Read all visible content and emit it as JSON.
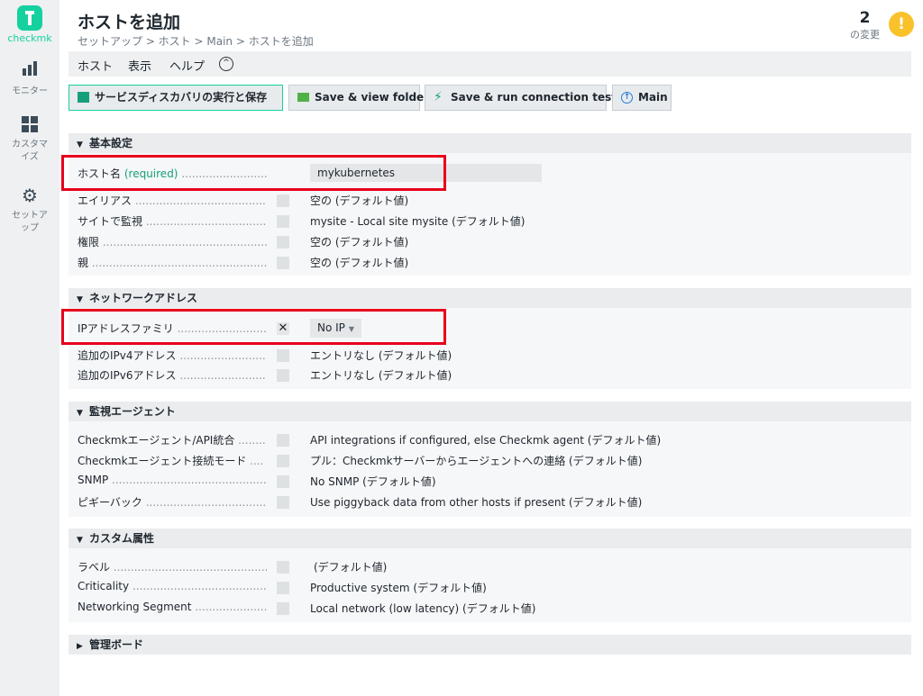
{
  "sidebar": {
    "logo": "checkmk",
    "items": [
      {
        "label": "モニター"
      },
      {
        "label": "カスタマイズ"
      },
      {
        "label": "セットアップ"
      }
    ]
  },
  "header": {
    "title": "ホストを追加",
    "breadcrumb": "セットアップ > ホスト > Main > ホストを追加",
    "changes_count": "2",
    "changes_label": "の変更",
    "warning": "!"
  },
  "menubar": [
    "ホスト",
    "表示",
    "ヘルプ"
  ],
  "menu_toggle": "^",
  "toolbar": {
    "discovery_save": "サービスディスカバリの実行と保存",
    "save_view_folder": "Save & view folder",
    "save_run_tests": "Save & run connection tests",
    "main": "Main"
  },
  "sections": {
    "basic": {
      "title": "基本設定",
      "hostname_label": "ホスト名",
      "hostname_required": "(required)",
      "hostname_value": "mykubernetes",
      "rows": [
        {
          "label": "エイリアス",
          "value": "空の (デフォルト値)"
        },
        {
          "label": "サイトで監視",
          "value": "mysite - Local site mysite (デフォルト値)"
        },
        {
          "label": "権限",
          "value": "空の (デフォルト値)"
        },
        {
          "label": "親",
          "value": "空の (デフォルト値)"
        }
      ]
    },
    "network": {
      "title": "ネットワークアドレス",
      "ip_family_label": "IPアドレスファミリ",
      "ip_family_value": "No IP",
      "rows": [
        {
          "label": "追加のIPv4アドレス",
          "value": "エントリなし (デフォルト値)"
        },
        {
          "label": "追加のIPv6アドレス",
          "value": "エントリなし (デフォルト値)"
        }
      ]
    },
    "agent": {
      "title": "監視エージェント",
      "rows": [
        {
          "label": "Checkmkエージェント/API統合",
          "value": "API integrations if configured, else Checkmk agent (デフォルト値)"
        },
        {
          "label": "Checkmkエージェント接続モード",
          "value": "プル：Checkmkサーバーからエージェントへの連絡 (デフォルト値)"
        },
        {
          "label": "SNMP",
          "value": "No SNMP (デフォルト値)"
        },
        {
          "label": "ピギーバック",
          "value": "Use piggyback data from other hosts if present (デフォルト値)"
        }
      ]
    },
    "custom": {
      "title": "カスタム属性",
      "rows": [
        {
          "label": "ラベル",
          "value": "(デフォルト値)"
        },
        {
          "label": "Criticality",
          "value": "Productive system (デフォルト値)"
        },
        {
          "label": "Networking Segment",
          "value": "Local network (low latency) (デフォルト値)"
        }
      ]
    },
    "management": {
      "title": "管理ボード"
    }
  },
  "colors": {
    "accent": "#15d1a0",
    "highlight": "#e8001c",
    "warning": "#f9c22b"
  }
}
